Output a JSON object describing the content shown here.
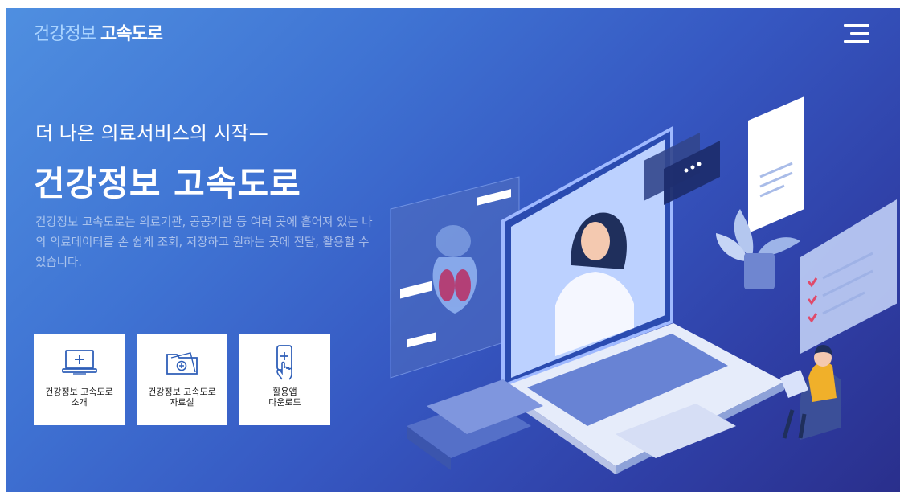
{
  "header": {
    "logo_part1": "건강정보",
    "logo_part2": "고속도로",
    "menu_icon": "hamburger-menu-icon"
  },
  "hero": {
    "subtitle": "더 나은 의료서비스의 시작—",
    "title": "건강정보 고속도로",
    "description": "건강정보 고속도로는 의료기관, 공공기관 등 여러 곳에 흩어져 있는 나의 의료데이터를 손 쉽게 조회, 저장하고 원하는 곳에 전달, 활용할 수 있습니다."
  },
  "cards": [
    {
      "label": "건강정보 고속도로\n소개",
      "icon": "monitor-medical-icon"
    },
    {
      "label": "건강정보 고속도로\n자료실",
      "icon": "folder-icon"
    },
    {
      "label": "활용앱\n다운로드",
      "icon": "phone-tap-icon"
    }
  ],
  "colors": {
    "bg_start": "#4f8fe0",
    "bg_end": "#2a2f8c",
    "icon_accent": "#2f5fb8",
    "medical_red": "#e04a6a"
  }
}
